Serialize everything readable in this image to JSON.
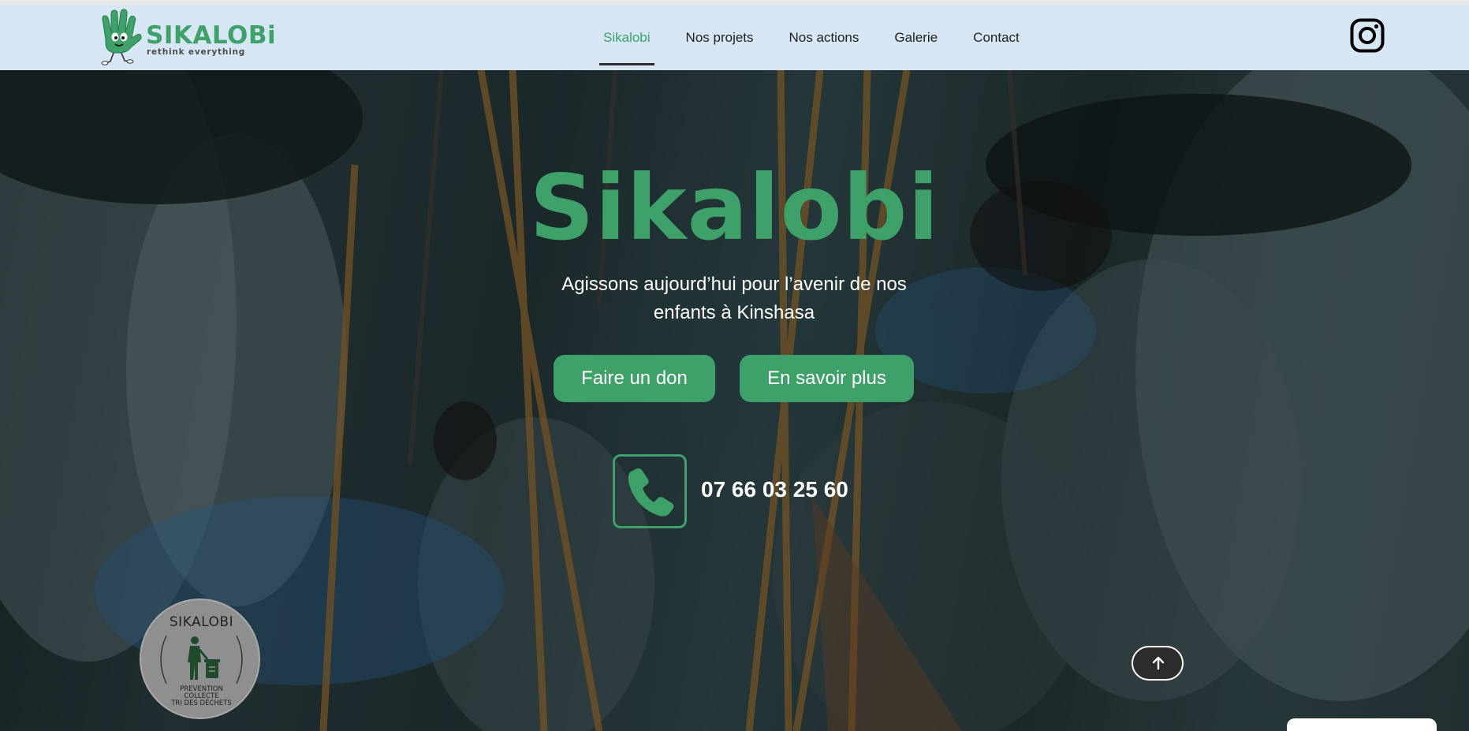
{
  "header": {
    "logo": {
      "wordmark": "SIKALOBi",
      "tagline": "rethink everything",
      "icon": "green-glove-mascot-icon",
      "brand_color": "#3fa16a"
    },
    "nav": {
      "items": [
        {
          "label": "Sikalobi",
          "active": true
        },
        {
          "label": "Nos projets",
          "active": false
        },
        {
          "label": "Nos actions",
          "active": false
        },
        {
          "label": "Galerie",
          "active": false
        },
        {
          "label": "Contact",
          "active": false
        }
      ]
    },
    "social": {
      "icon": "instagram-icon"
    },
    "background": "#d6e6f5"
  },
  "hero": {
    "title": "Sikalobi",
    "subtitle": "Agissons aujourd’hui pour l’avenir de nos enfants à Kinshasa",
    "buttons": {
      "donate": "Faire un don",
      "learn_more": "En savoir plus"
    },
    "phone": {
      "icon": "phone-icon",
      "number": "07 66 03 25 60"
    },
    "accent_color": "#3fa16a"
  },
  "badge": {
    "title": "SIKALOBI",
    "icon": "trash-bin-person-icon",
    "lines": [
      "PREVENTION",
      "COLLECTE",
      "TRI DES DÉCHETS"
    ]
  },
  "scroll_top": {
    "icon": "arrow-up-icon"
  }
}
